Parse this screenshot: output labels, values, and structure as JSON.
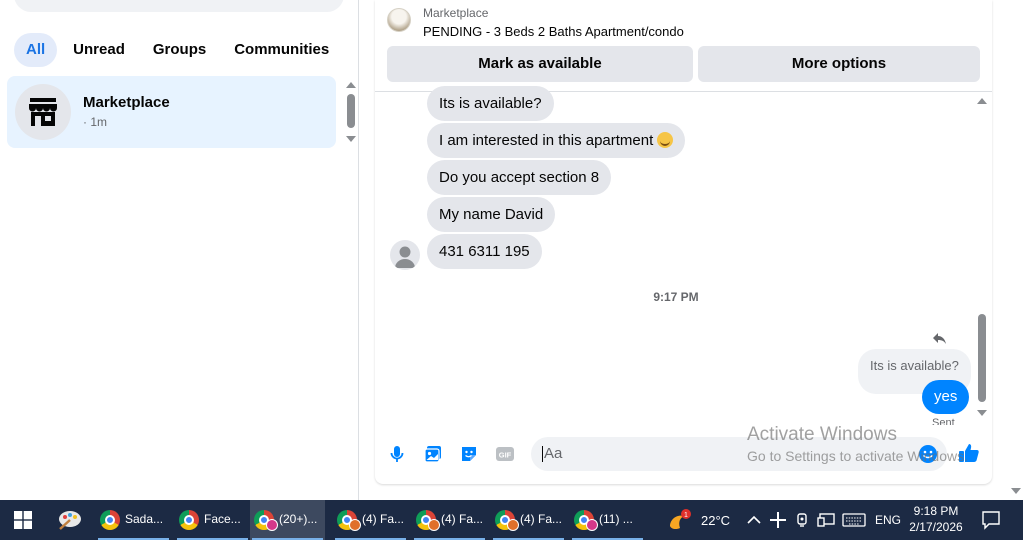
{
  "sidebar": {
    "filters": [
      "All",
      "Unread",
      "Groups",
      "Communities"
    ],
    "active_filter": "All",
    "conversation": {
      "name": "Marketplace",
      "meta": "· 1m"
    }
  },
  "chat": {
    "header": {
      "label": "Marketplace",
      "title": "PENDING - 3 Beds 2 Baths Apartment/condo"
    },
    "buttons": {
      "mark_available": "Mark as available",
      "more_options": "More options"
    },
    "incoming": [
      "Its is available?",
      "I am interested in this apartment",
      "Do you accept section 8",
      "My name David",
      "431 6311 195"
    ],
    "timestamp": "9:17 PM",
    "reply_quote": "Its is available?",
    "outgoing": "yes",
    "status": "Sent",
    "composer": {
      "placeholder": "Aa"
    }
  },
  "watermark": {
    "title": "Activate Windows",
    "subtitle": "Go to Settings to activate Windows."
  },
  "taskbar": {
    "apps": [
      {
        "label": "Sada...",
        "active": false
      },
      {
        "label": "Face...",
        "active": false
      },
      {
        "label": "(20+)...",
        "active": true
      },
      {
        "label": "(4) Fa...",
        "active": false
      },
      {
        "label": "(4) Fa...",
        "active": false
      },
      {
        "label": "(4) Fa...",
        "active": false
      },
      {
        "label": "(11) ...",
        "active": false
      }
    ],
    "weather": "22°C",
    "weather_badge": "1",
    "language": "ENG",
    "time": "9:18 PM",
    "date": "2/17/2026"
  },
  "colors": {
    "accent": "#0084ff",
    "selected_bg": "#e7f3ff",
    "taskbar": "#1c2a44"
  }
}
